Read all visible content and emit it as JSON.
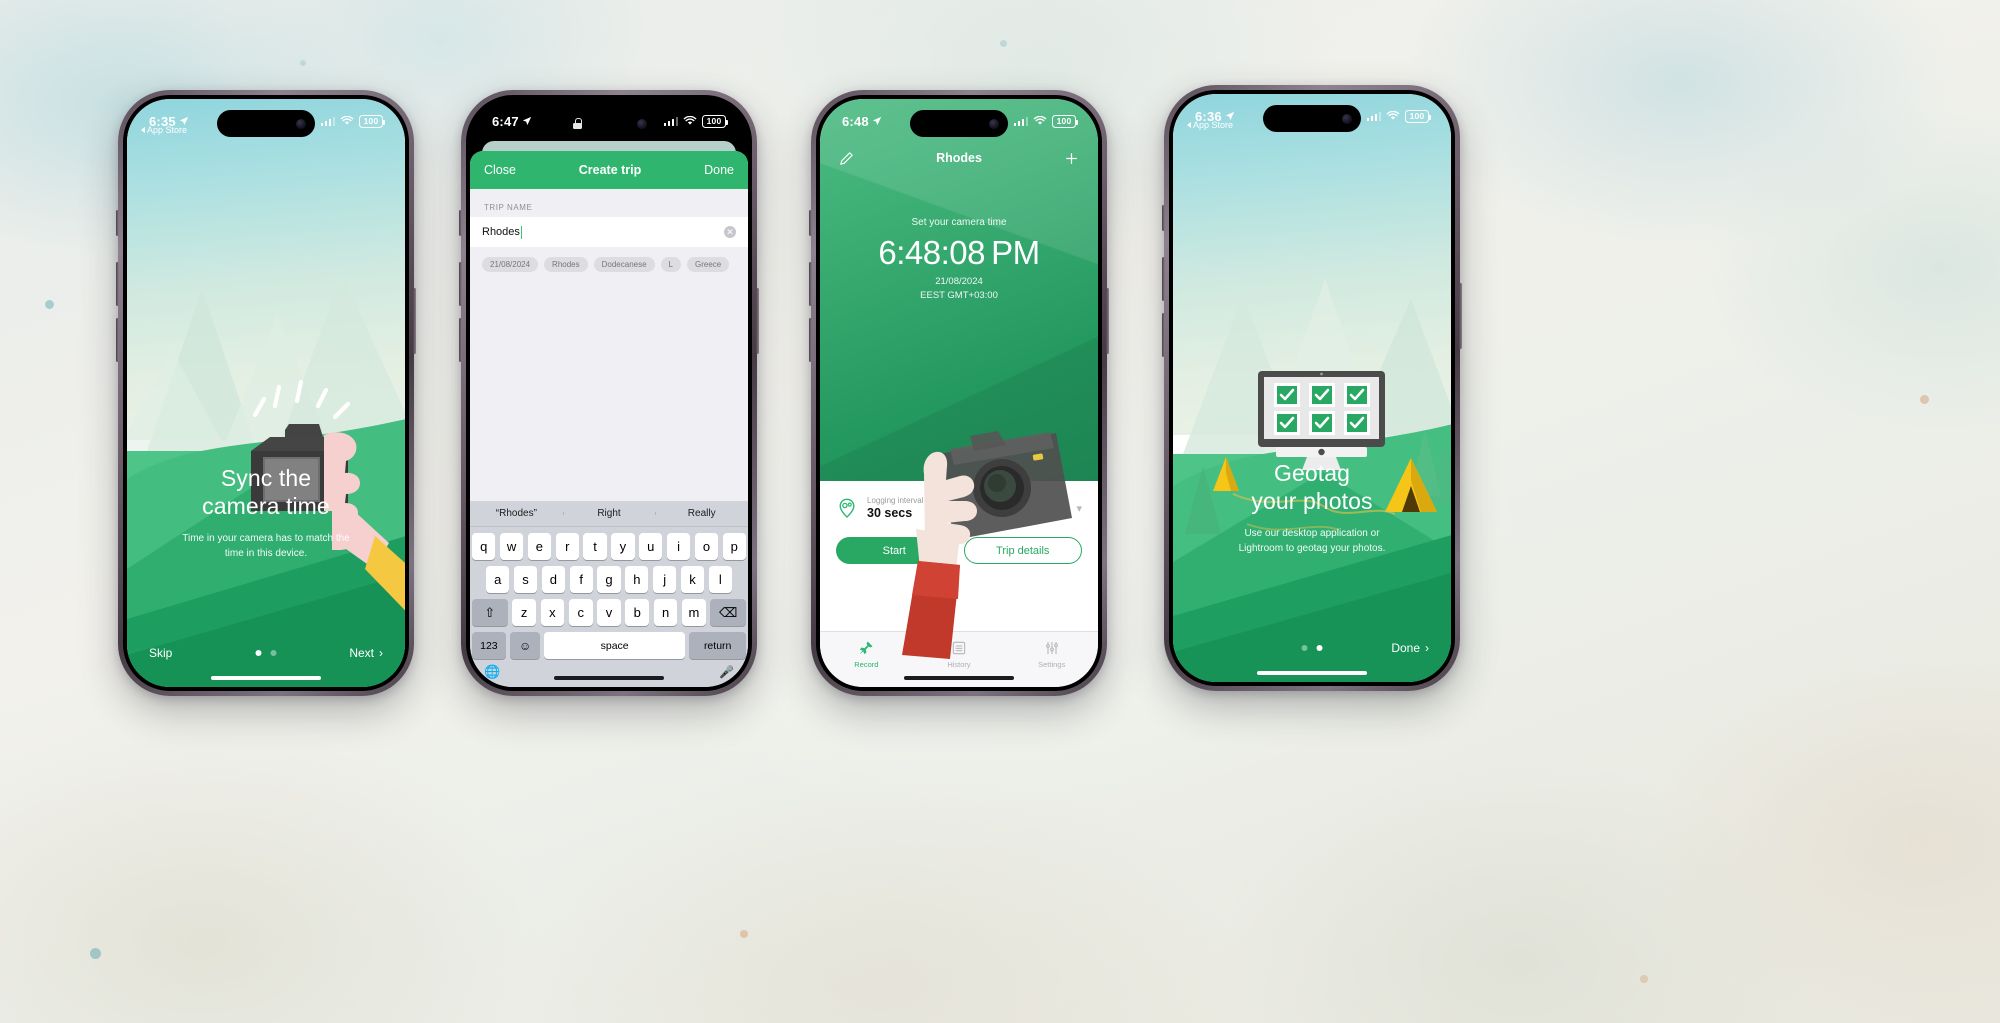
{
  "phones": [
    {
      "id": "onboarding-sync",
      "status_bar": {
        "time": "6:35",
        "battery": "100",
        "location_icon": "location-arrow-icon",
        "signal_icon": "cellular-signal-icon",
        "wifi_icon": "wifi-icon"
      },
      "back_link": "App Store",
      "illustration": "hand-holding-camera-flash",
      "title_line1": "Sync the",
      "title_line2": "camera time",
      "subtitle_line1": "Time in your camera has to match the",
      "subtitle_line2": "time in this device.",
      "skip_label": "Skip",
      "next_label": "Next",
      "next_chevron": "chevron-right-icon",
      "page_dots": {
        "count": 2,
        "active": 0
      }
    },
    {
      "id": "create-trip",
      "status_bar": {
        "time": "6:47",
        "battery": "100",
        "lock_icon": "lock-icon"
      },
      "navbar": {
        "close": "Close",
        "title": "Create trip",
        "done": "Done"
      },
      "form": {
        "field_label": "TRIP NAME",
        "field_value": "Rhodes",
        "clear_icon": "clear-circle-icon",
        "chips": [
          "21/08/2024",
          "Rhodes",
          "Dodecanese",
          "L",
          "Greece"
        ]
      },
      "keyboard": {
        "suggestions": [
          "“Rhodes”",
          "Right",
          "Really"
        ],
        "row1": [
          "q",
          "w",
          "e",
          "r",
          "t",
          "y",
          "u",
          "i",
          "o",
          "p"
        ],
        "row2": [
          "a",
          "s",
          "d",
          "f",
          "g",
          "h",
          "j",
          "k",
          "l"
        ],
        "row3": [
          "z",
          "x",
          "c",
          "v",
          "b",
          "n",
          "m"
        ],
        "shift_icon": "shift-up-icon",
        "backspace_icon": "backspace-icon",
        "numbers_key": "123",
        "emoji_icon": "emoji-smiley-icon",
        "space_key": "space",
        "return_key": "return",
        "globe_icon": "globe-icon",
        "mic_icon": "microphone-icon"
      }
    },
    {
      "id": "record-rhodes",
      "status_bar": {
        "time": "6:48",
        "battery": "100"
      },
      "navbar": {
        "edit_icon": "pencil-edit-icon",
        "title": "Rhodes",
        "add_icon": "plus-icon"
      },
      "camera_time": {
        "caption": "Set your camera time",
        "clock": "6:48:08 PM",
        "date": "21/08/2024",
        "timezone": "EEST GMT+03:00"
      },
      "illustration": "hand-red-sleeve-holding-camera",
      "interval": {
        "icon": "location-pin-timer-icon",
        "label": "Logging interval",
        "value": "30 secs",
        "chevron": "chevron-down-icon"
      },
      "buttons": {
        "start": "Start",
        "details": "Trip details"
      },
      "tabs": [
        {
          "label": "Record",
          "icon": "pin-icon",
          "active": true
        },
        {
          "label": "History",
          "icon": "list-lines-icon",
          "active": false
        },
        {
          "label": "Settings",
          "icon": "sliders-icon",
          "active": false
        }
      ]
    },
    {
      "id": "onboarding-geotag",
      "status_bar": {
        "time": "6:36",
        "battery": "100"
      },
      "back_link": "App Store",
      "illustration": "desktop-monitor-six-green-checkmarks",
      "title_line1": "Geotag",
      "title_line2": "your photos",
      "subtitle_line1": "Use our desktop application or",
      "subtitle_line2": "Lightroom to geotag your photos.",
      "done_label": "Done",
      "done_chevron": "chevron-right-icon",
      "page_dots": {
        "count": 2,
        "active": 1
      }
    }
  ],
  "colors": {
    "brand_green": "#28a862",
    "nav_green": "#2fb56e",
    "accent_green": "#34c77b",
    "sky_teal": "#8fd5dd",
    "hill_green": "#1f8f59"
  }
}
